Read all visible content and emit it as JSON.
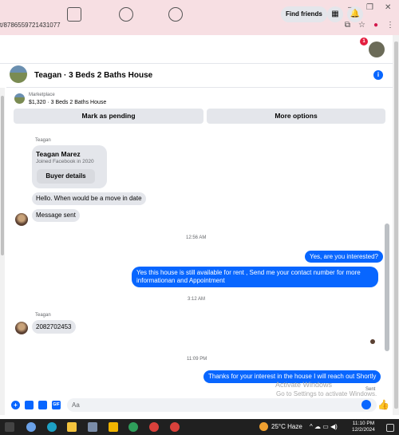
{
  "browser": {
    "url": "t/8786559721431077",
    "window_controls": [
      "–",
      "❐",
      "✕"
    ]
  },
  "fbnav": {
    "find_friends": "Find friends",
    "notification_count": "1"
  },
  "chat": {
    "title": "Teagan · 3 Beds 2 Baths House",
    "marketplace_label": "Marketplace",
    "listing": "$1,320 · 3 Beds 2 Baths House",
    "mark_pending": "Mark as pending",
    "more_options": "More options"
  },
  "messages": {
    "sender1": "Teagan",
    "card_name": "Teagan Marez",
    "card_sub": "Joined Facebook in 2020",
    "card_button": "Buyer details",
    "msg1": "Hello. When would be a move in date",
    "msg2": "Message sent",
    "time1": "12:56 AM",
    "out1": "Yes, are you interested?",
    "out2": "Yes this house is still available for rent , Send me your contact number for more informationan and Appointment",
    "time2": "3:12 AM",
    "sender2": "Teagan",
    "msg3": "2082702453",
    "time3": "11:09 PM",
    "out3": "Thanks for your interest in the house I will reach out Shortly",
    "sent_label": "Sent"
  },
  "watermark": {
    "line1": "Activate Windows",
    "line2": "Go to Settings to activate Windows."
  },
  "composer": {
    "placeholder": "Aa"
  },
  "taskbar": {
    "weather": "25°C  Haze",
    "time": "11:10 PM",
    "date": "12/2/2024"
  },
  "colors": {
    "messenger_blue": "#0866ff",
    "bubble_gray": "#e4e6eb",
    "chrome_pink": "#f7dfe3",
    "taskbar": "#202020"
  }
}
